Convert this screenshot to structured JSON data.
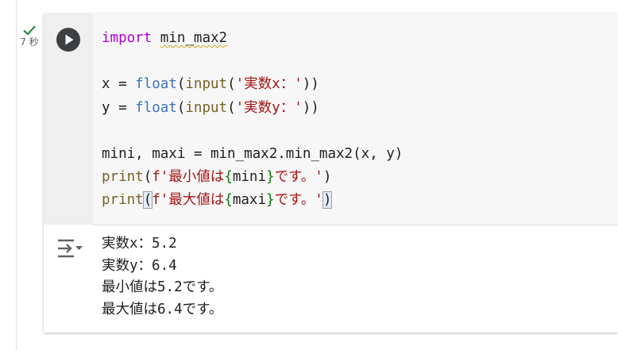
{
  "cell": {
    "status": "success",
    "exec_time": "7 秒",
    "code_lines": [
      [
        {
          "t": "import",
          "c": "kw"
        },
        {
          "t": " ",
          "c": "plain"
        },
        {
          "t": "min_max2",
          "c": "squiggle"
        }
      ],
      [],
      [
        {
          "t": "x = ",
          "c": "plain"
        },
        {
          "t": "float",
          "c": "bi"
        },
        {
          "t": "(",
          "c": "plain"
        },
        {
          "t": "input",
          "c": "fn"
        },
        {
          "t": "(",
          "c": "plain"
        },
        {
          "t": "'実数x：'",
          "c": "str"
        },
        {
          "t": "))",
          "c": "plain"
        }
      ],
      [
        {
          "t": "y = ",
          "c": "plain"
        },
        {
          "t": "float",
          "c": "bi"
        },
        {
          "t": "(",
          "c": "plain"
        },
        {
          "t": "input",
          "c": "fn"
        },
        {
          "t": "(",
          "c": "plain"
        },
        {
          "t": "'実数y：'",
          "c": "str"
        },
        {
          "t": "))",
          "c": "plain"
        }
      ],
      [],
      [
        {
          "t": "mini, maxi = min_max2.min_max2(x, y)",
          "c": "plain"
        }
      ],
      [
        {
          "t": "print",
          "c": "fn"
        },
        {
          "t": "(",
          "c": "plain"
        },
        {
          "t": "f'最小値は",
          "c": "str"
        },
        {
          "t": "{",
          "c": "brace"
        },
        {
          "t": "mini",
          "c": "plain"
        },
        {
          "t": "}",
          "c": "brace"
        },
        {
          "t": "です。'",
          "c": "str"
        },
        {
          "t": ")",
          "c": "plain"
        }
      ],
      [
        {
          "t": "print",
          "c": "fn"
        },
        {
          "t": "(",
          "c": "bracket-match"
        },
        {
          "t": "f'最大値は",
          "c": "str"
        },
        {
          "t": "{",
          "c": "brace"
        },
        {
          "t": "maxi",
          "c": "plain"
        },
        {
          "t": "}",
          "c": "brace"
        },
        {
          "t": "です。'",
          "c": "str"
        },
        {
          "t": ")",
          "c": "bracket-match"
        }
      ]
    ]
  },
  "output": {
    "lines": [
      "実数x：5.2",
      "実数y：6.4",
      "最小値は5.2です。",
      "最大値は6.4です。"
    ]
  },
  "colors": {
    "keyword": "#af00db",
    "builtin": "#3b72c1",
    "function": "#795e26",
    "string": "#a31515",
    "brace": "#0b7a0b",
    "success": "#188038",
    "gutter": "#efefef",
    "editor": "#f7f7f7"
  },
  "icons": {
    "status": "check-icon",
    "run": "play-icon",
    "output_toggle": "output-collapse-icon"
  }
}
